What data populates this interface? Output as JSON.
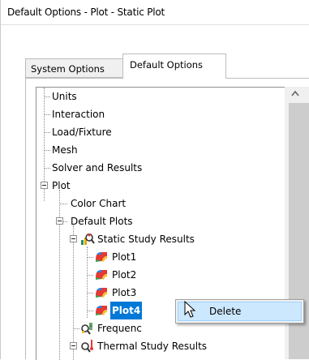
{
  "window": {
    "title": "Default Options - Plot - Static Plot"
  },
  "tabs": [
    {
      "label": "System Options",
      "active": false
    },
    {
      "label": "Default Options",
      "active": true
    }
  ],
  "tree": {
    "units": "Units",
    "interaction": "Interaction",
    "load_fixture": "Load/Fixture",
    "mesh": "Mesh",
    "solver_results": "Solver and Results",
    "plot": "Plot",
    "color_chart": "Color Chart",
    "default_plots": "Default Plots",
    "static_study_results": "Static Study Results",
    "plot1": "Plot1",
    "plot2": "Plot2",
    "plot3": "Plot3",
    "plot4": "Plot4",
    "frequency_partial": "Frequenc",
    "thermal_partial": "Thermal Study Results",
    "selected_item": "Plot4"
  },
  "icons": {
    "static_study": "magnifier-plot-icon",
    "plot": "colored-plot-icon",
    "frequency": "frequency-study-icon",
    "thermal": "thermal-study-icon"
  },
  "context_menu": {
    "items": [
      {
        "label": "Delete",
        "highlighted": true
      }
    ]
  },
  "colors": {
    "selection": "#0078d7",
    "menu_highlight": "#cce8ff",
    "menu_border": "#99d1ff"
  }
}
